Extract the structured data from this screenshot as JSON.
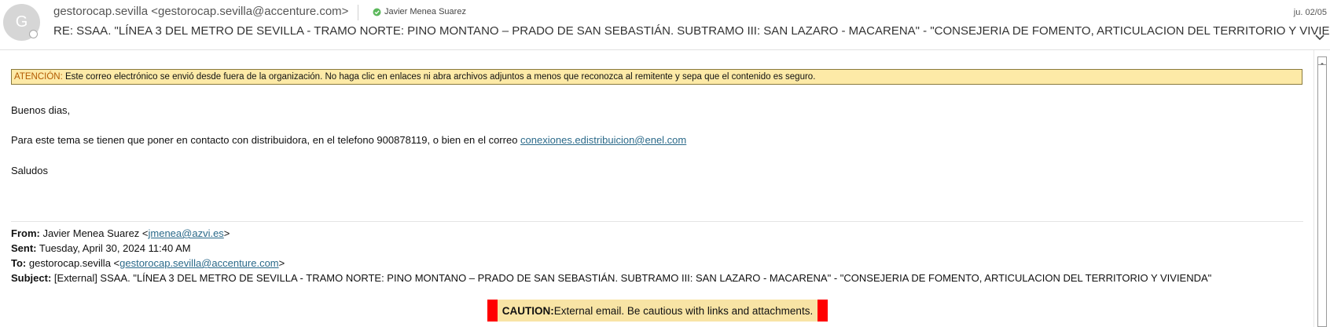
{
  "header": {
    "avatar_initial": "G",
    "sender": "gestorocap.sevilla <gestorocap.sevilla@accenture.com>",
    "recipient": "Javier Menea Suarez",
    "date": "ju. 02/05",
    "subject": "RE: SSAA. \"LÍNEA 3 DEL METRO DE SEVILLA - TRAMO NORTE: PINO MONTANO – PRADO DE SAN SEBASTIÁN. SUBTRAMO III: SAN LAZARO - MACARENA\" - \"CONSEJERIA DE FOMENTO, ARTICULACION DEL TERRITORIO Y VIVIENDA\""
  },
  "warning": {
    "lead": "ATENCIÓN:",
    "text": " Este correo electrónico se envió desde fuera de la organización. No haga clic en enlaces ni abra archivos adjuntos a menos que reconozca al remitente y sepa que el contenido es seguro."
  },
  "body": {
    "greeting": "Buenos dias,",
    "message": "Para este tema se tienen que poner en contacto con distribuidora, en el telefono 900878119, o bien en el correo ",
    "message_link": "conexiones.edistribuicion@enel.com",
    "signoff": "Saludos"
  },
  "quoted": {
    "from_label": "From:",
    "from_name": " Javier Menea Suarez <",
    "from_email": "jmenea@azvi.es",
    "from_close": ">",
    "sent_label": "Sent:",
    "sent_value": " Tuesday, April 30, 2024 11:40 AM",
    "to_label": "To:",
    "to_name": " gestorocap.sevilla <",
    "to_email": "gestorocap.sevilla@accenture.com",
    "to_close": ">",
    "subject_label": "Subject:",
    "subject_value": " [External] SSAA. \"LÍNEA 3 DEL METRO DE SEVILLA - TRAMO NORTE: PINO MONTANO – PRADO DE SAN SEBASTIÁN. SUBTRAMO III: SAN LAZARO - MACARENA\" - \"CONSEJERIA DE FOMENTO, ARTICULACION DEL TERRITORIO Y VIVIENDA\""
  },
  "caution": {
    "label": "CAUTION:",
    "text": " External email. Be cautious with links and attachments."
  },
  "colors": {
    "warning_bg": "#fdeaa7",
    "caution_bar": "#ff0000",
    "link": "#2b6a8a",
    "verified_check": "#5cb85c"
  },
  "icons": {
    "verified": "check-circle-icon",
    "expand": "chevron-down-icon",
    "scroll_up": "arrow-up-icon",
    "presence": "presence-icon"
  }
}
